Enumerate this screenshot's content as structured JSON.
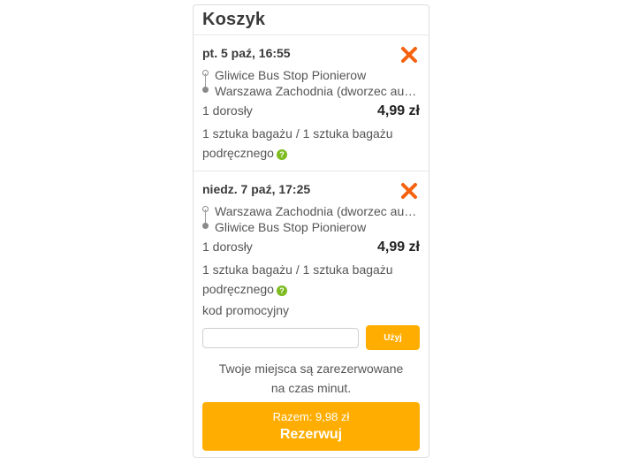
{
  "cart": {
    "title": "Koszyk",
    "trips": [
      {
        "date": "pt. 5 paź, 16:55",
        "from": "Gliwice Bus Stop Pionierow",
        "to": "Warszawa Zachodnia (dworzec aut…",
        "passengers": "1 dorosły",
        "price": "4,99 zł",
        "baggage": "1 sztuka bagażu / 1 sztuka bagażu podręcznego"
      },
      {
        "date": "niedz. 7 paź, 17:25",
        "from": "Warszawa Zachodnia (dworzec aut…",
        "to": "Gliwice Bus Stop Pionierow",
        "passengers": "1 dorosły",
        "price": "4,99 zł",
        "baggage": "1 sztuka bagażu / 1 sztuka bagażu podręcznego"
      }
    ],
    "promo": {
      "label": "kod promocyjny",
      "value": "",
      "placeholder": "",
      "button_label": "Użyj"
    },
    "reservation_note_before": "Twoje miejsca są zarezerwowane na czas",
    "reservation_timer": "",
    "reservation_note_after": "minut.",
    "checkout": {
      "total": "Razem: 9,98 zł",
      "label": "Rezerwuj"
    }
  },
  "colors": {
    "accent": "#ffad00",
    "remove": "#f5620f",
    "help": "#7dbb1f"
  },
  "icons": {
    "remove": "close-icon",
    "help": "help-icon",
    "route": "route-icon"
  }
}
